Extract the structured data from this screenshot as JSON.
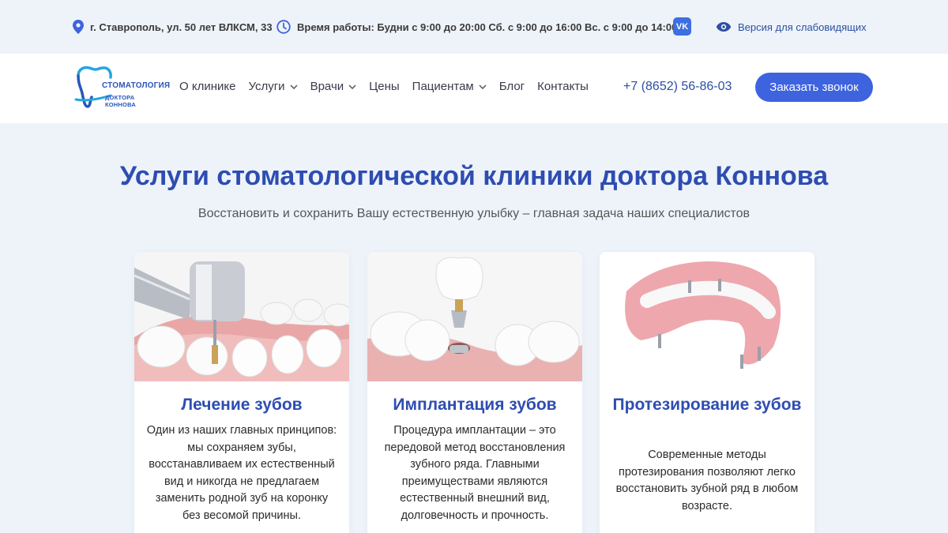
{
  "topbar": {
    "address": "г. Ставрополь, ул. 50 лет ВЛКСМ, 33",
    "hours": "Время работы: Будни с 9:00 до 20:00  Сб. с 9:00 до 16:00  Вс. с 9:00 до 14:00",
    "vk_label": "VK",
    "accessibility": "Версия для слабовидящих",
    "icons": [
      "location-pin-icon",
      "clock-icon",
      "vk-icon",
      "eye-icon"
    ]
  },
  "header": {
    "logo_line1": "СТОМАТОЛОГИЯ",
    "logo_line2": "ДОКТОРА КОННОВА",
    "nav": [
      {
        "label": "О клинике",
        "dropdown": false
      },
      {
        "label": "Услуги",
        "dropdown": true
      },
      {
        "label": "Врачи",
        "dropdown": true
      },
      {
        "label": "Цены",
        "dropdown": false
      },
      {
        "label": "Пациентам",
        "dropdown": true
      },
      {
        "label": "Блог",
        "dropdown": false
      },
      {
        "label": "Контакты",
        "dropdown": false
      }
    ],
    "phone": "+7 (8652) 56-86-03",
    "call_button": "Заказать звонок"
  },
  "hero": {
    "title": "Услуги стоматологической клиники доктора Коннова",
    "subtitle": "Восстановить и сохранить Вашу естественную улыбку – главная задача наших специалистов"
  },
  "cards": [
    {
      "title": "Лечение зубов",
      "text": "Один из наших главных принципов: мы сохраняем зубы, восстанавливаем их естественный вид и никогда не предлагаем заменить родной зуб на коронку без весомой причины."
    },
    {
      "title": "Имплантация зубов",
      "text": "Процедура имплантации – это передовой метод восстановления зубного ряда. Главными преимуществами являются естественный внешний вид, долговечность и прочность."
    },
    {
      "title": "Протезирование зубов",
      "text": "Современные методы протезирования позволяют легко восстановить зубной ряд в любом возрасте."
    }
  ],
  "colors": {
    "accent": "#3e63de",
    "heading": "#2e4db1",
    "background": "#eef3fa"
  }
}
